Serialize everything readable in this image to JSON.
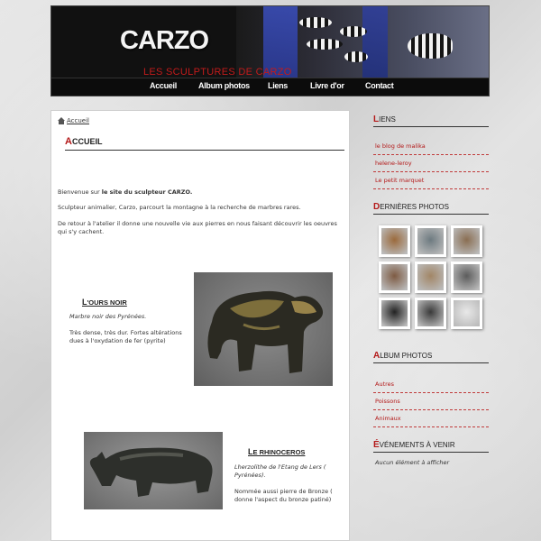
{
  "header": {
    "logo": "CARZO",
    "tagline": "LES SCULPTURES DE CARZO",
    "nav": [
      {
        "label": "Accueil"
      },
      {
        "label": "Album photos"
      },
      {
        "label": "Liens"
      },
      {
        "label": "Livre d'or"
      },
      {
        "label": "Contact"
      }
    ]
  },
  "breadcrumb": {
    "label": "Accueil"
  },
  "page": {
    "title_cap": "A",
    "title_rest": "CCUEIL",
    "intro": {
      "p1_prefix": "Bienvenue sur ",
      "p1_bold": "le site du sculpteur CARZO.",
      "p2": "Sculpteur animalier, Carzo, parcourt la montagne à la recherche de marbres rares.",
      "p3": "De retour à l'atelier il donne une nouvelle vie aux pierres en nous faisant découvrir les oeuvres qui s'y cachent."
    },
    "sections": [
      {
        "title_cap": "L",
        "title_rest": "'OURS NOIR",
        "subtitle": "Marbre noir des Pyrénées.",
        "text": "Très dense, très dur. Fortes altérations dues à l'oxydation de fer (pyrite)"
      },
      {
        "title_cap": "L",
        "title_rest": "E RHINOCEROS",
        "subtitle": "Lherzolithe de l'Etang de Lers ( Pyrénées).",
        "text": "Nommée aussi pierre de Bronze ( donne l'aspect du bronze patiné)"
      }
    ]
  },
  "sidebar": {
    "liens": {
      "title_cap": "L",
      "title_rest": "IENS",
      "items": [
        {
          "label": "le blog de malika"
        },
        {
          "label": "helene-leroy"
        },
        {
          "label": "Le petit marquet"
        }
      ]
    },
    "photos": {
      "title_cap": "D",
      "title_rest": "ERNIÈRES PHOTOS",
      "thumb_colors": [
        "#9b6a3c",
        "#6d7a80",
        "#8a6e52",
        "#7e5b43",
        "#a28666",
        "#5c5c5c",
        "#222222",
        "#3a3a3a",
        "#e8e8e8"
      ]
    },
    "album": {
      "title_cap": "A",
      "title_rest": "LBUM PHOTOS",
      "items": [
        {
          "label": "Autres"
        },
        {
          "label": "Poissons"
        },
        {
          "label": "Animaux"
        }
      ]
    },
    "events": {
      "title_cap": "É",
      "title_rest": "VÉNEMENTS À VENIR",
      "empty": "Aucun élément à afficher"
    }
  },
  "colors": {
    "accent": "#b31818",
    "header_bg": "#111111"
  }
}
